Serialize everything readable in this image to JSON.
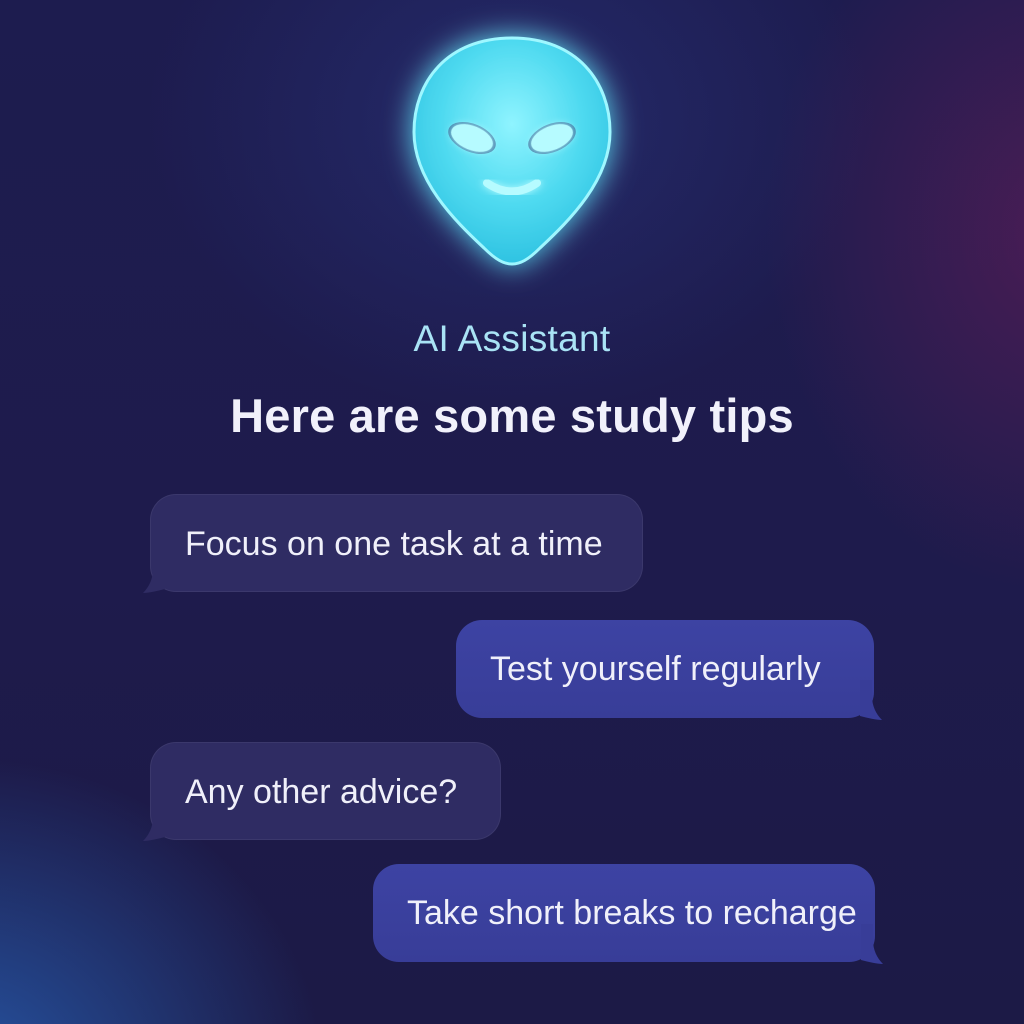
{
  "assistant": {
    "name": "AI Assistant",
    "avatar_icon": "alien-face-icon",
    "avatar_color": "#3fe6f5"
  },
  "headline": "Here are some study tips",
  "messages": [
    {
      "sender": "incoming",
      "text": "Focus on one task at a time"
    },
    {
      "sender": "outgoing",
      "text": "Test yourself regularly"
    },
    {
      "sender": "incoming",
      "text": "Any other advice?"
    },
    {
      "sender": "outgoing",
      "text": "Take short breaks to recharge"
    }
  ],
  "colors": {
    "background": "#1e1b4c",
    "incoming_bubble": "#2f2c63",
    "outgoing_bubble": "#3b41a0",
    "assistant_name": "#a9e3f5",
    "headline_text": "#f1f1fb"
  }
}
